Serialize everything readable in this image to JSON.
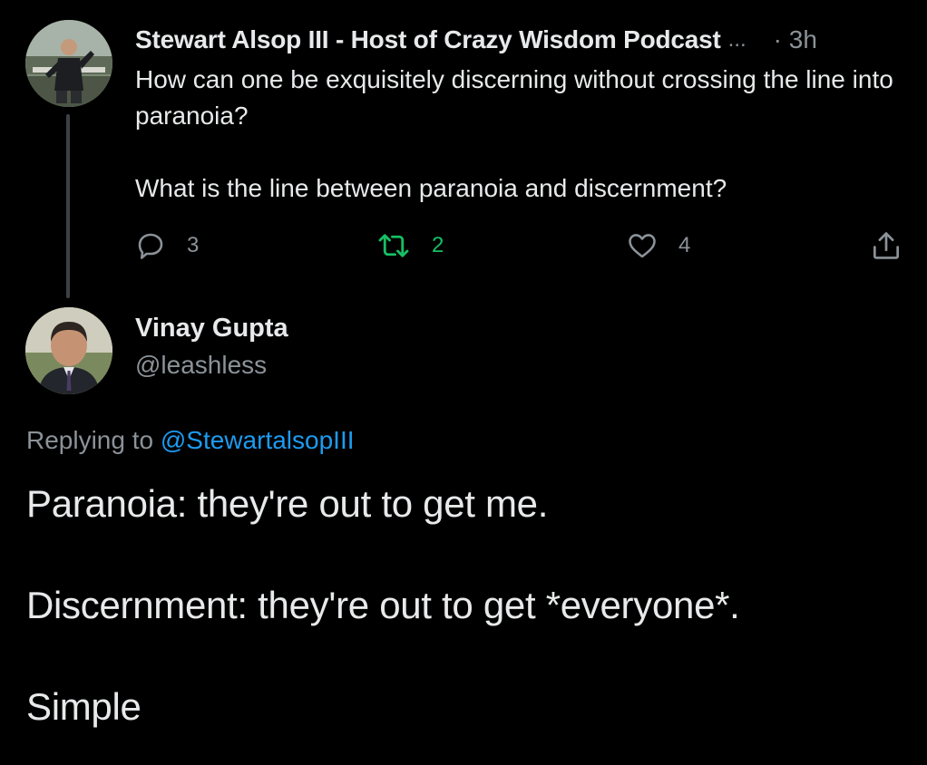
{
  "parent_tweet": {
    "author_name": "Stewart Alsop III - Host of Crazy Wisdom Podcast",
    "name_ellipsis": "...",
    "timestamp": "· 3h",
    "text": "How can one be exquisitely discerning without crossing the line into paranoia?\n\nWhat is the line between paranoia and discernment?",
    "actions": {
      "reply_icon": "speech-bubble-icon",
      "reply_count": "3",
      "retweet_icon": "retweet-icon",
      "retweet_count": "2",
      "like_icon": "heart-icon",
      "like_count": "4",
      "share_icon": "share-upload-icon"
    }
  },
  "reply_tweet": {
    "author_name": "Vinay Gupta",
    "handle": "@leashless",
    "replying_prefix": "Replying to",
    "replying_mention": "@StewartalsopIII",
    "text": "Paranoia: they're out to get me.\n\nDiscernment: they're out to get *everyone*.\n\nSimple"
  },
  "colors": {
    "background": "#000000",
    "text_primary": "#e7e9ea",
    "text_secondary": "#8b9298",
    "link": "#1d9bf0",
    "retweet_active": "#17bf63"
  }
}
